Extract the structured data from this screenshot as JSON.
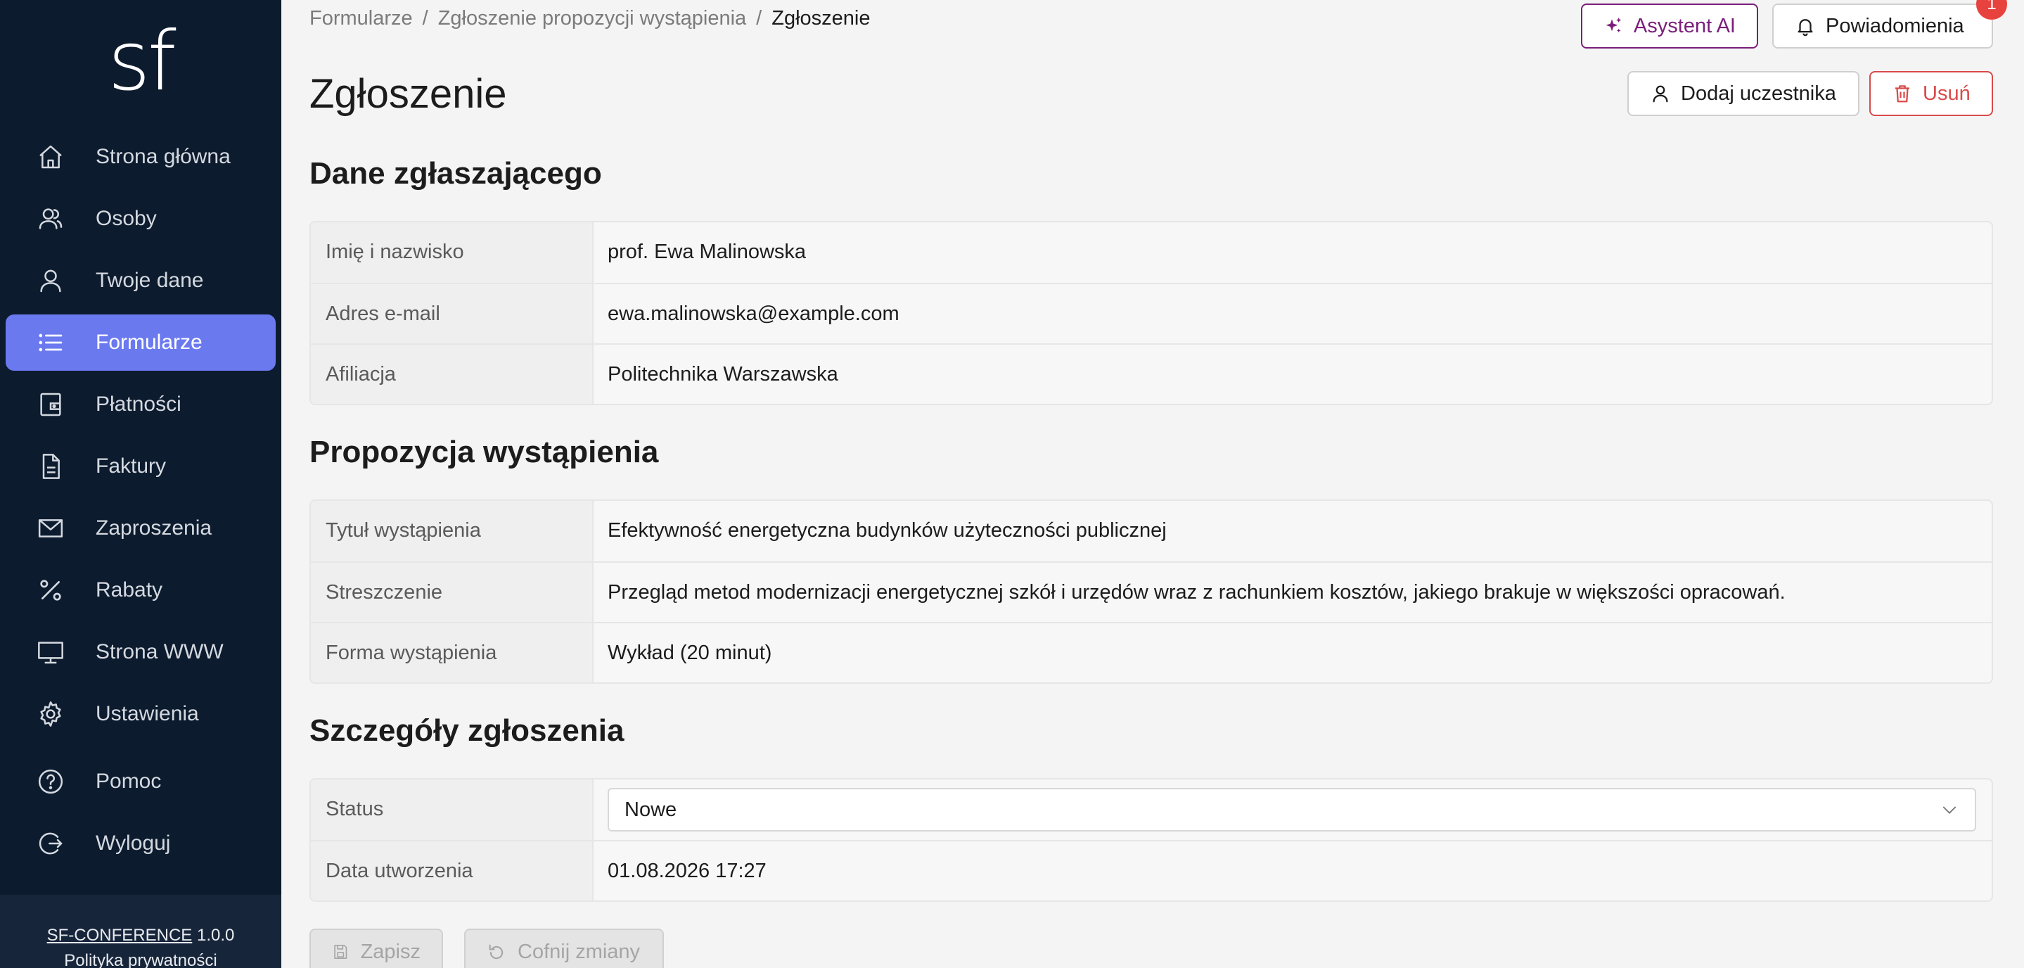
{
  "sidebar": {
    "logo": "sf",
    "items": [
      {
        "label": "Strona główna",
        "icon": "home-icon"
      },
      {
        "label": "Osoby",
        "icon": "users-icon"
      },
      {
        "label": "Twoje dane",
        "icon": "user-icon"
      },
      {
        "label": "Formularze",
        "icon": "list-icon",
        "active": true
      },
      {
        "label": "Płatności",
        "icon": "wallet-icon"
      },
      {
        "label": "Faktury",
        "icon": "document-icon"
      },
      {
        "label": "Zaproszenia",
        "icon": "mail-icon"
      },
      {
        "label": "Rabaty",
        "icon": "percent-icon"
      },
      {
        "label": "Strona WWW",
        "icon": "monitor-icon"
      },
      {
        "label": "Ustawienia",
        "icon": "gear-icon"
      },
      {
        "label": "Pomoc",
        "icon": "help-icon"
      },
      {
        "label": "Wyloguj",
        "icon": "logout-icon"
      }
    ],
    "footer": {
      "app_name": "SF-CONFERENCE",
      "version": "1.0.0",
      "privacy": "Polityka prywatności"
    },
    "active_color": "#6b79ef"
  },
  "breadcrumb": {
    "items": [
      "Formularze",
      "Zgłoszenie propozycji wystąpienia"
    ],
    "separator": "/",
    "current": "Zgłoszenie"
  },
  "header": {
    "ai_button": "Asystent AI",
    "notifications_button": "Powiadomienia",
    "notifications_count": "1",
    "add_participant_button": "Dodaj uczestnika",
    "delete_button": "Usuń"
  },
  "page_title": "Zgłoszenie",
  "sections": {
    "applicant": {
      "title": "Dane zgłaszającego",
      "rows": [
        {
          "label": "Imię i nazwisko",
          "value": "prof. Ewa Malinowska"
        },
        {
          "label": "Adres e-mail",
          "value": "ewa.malinowska@example.com"
        },
        {
          "label": "Afiliacja",
          "value": "Politechnika Warszawska"
        }
      ]
    },
    "proposal": {
      "title": "Propozycja wystąpienia",
      "rows": [
        {
          "label": "Tytuł wystąpienia",
          "value": "Efektywność energetyczna budynków użyteczności publicznej"
        },
        {
          "label": "Streszczenie",
          "value": "Przegląd metod modernizacji energetycznej szkół i urzędów wraz z rachunkiem kosztów, jakiego brakuje w większości opracowań."
        },
        {
          "label": "Forma wystąpienia",
          "value": "Wykład (20 minut)"
        }
      ]
    },
    "details": {
      "title": "Szczegóły zgłoszenia",
      "status_label": "Status",
      "status_value": "Nowe",
      "created_label": "Data utworzenia",
      "created_value": "01.08.2026 17:27"
    }
  },
  "actions": {
    "save": "Zapisz",
    "revert": "Cofnij zmiany"
  }
}
